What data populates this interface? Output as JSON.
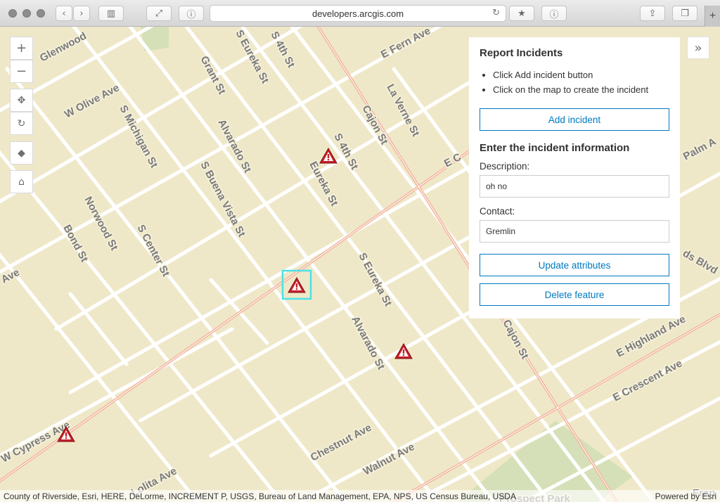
{
  "browser": {
    "url": "developers.arcgis.com"
  },
  "map": {
    "road_color": "#ffffff",
    "highway_color": "#f2b59e",
    "land_color": "#efe8c8",
    "park_color": "#d5e0b8",
    "accent_color": "#4ee0e6",
    "incident_icon": "warning-triangle-icon",
    "street_labels": [
      {
        "text": "Glenwood"
      },
      {
        "text": "W Olive Ave"
      },
      {
        "text": "S Michigan St"
      },
      {
        "text": "Grant St"
      },
      {
        "text": "S Eureka St"
      },
      {
        "text": "S 4th St"
      },
      {
        "text": "E Fern Ave"
      },
      {
        "text": "La Verne St"
      },
      {
        "text": "Cajon St"
      },
      {
        "text": "Alvarado St"
      },
      {
        "text": "S 4th St"
      },
      {
        "text": "Eureka St"
      },
      {
        "text": "S Buena Vista St"
      },
      {
        "text": "Norwood St"
      },
      {
        "text": "Bond St"
      },
      {
        "text": "S Center St"
      },
      {
        "text": "Ave"
      },
      {
        "text": "S Eureka St"
      },
      {
        "text": "Alvarado St"
      },
      {
        "text": "Cajon St"
      },
      {
        "text": "E Highland Ave"
      },
      {
        "text": "E Crescent Ave"
      },
      {
        "text": "Palm A"
      },
      {
        "text": "ds Blvd"
      },
      {
        "text": "E C"
      },
      {
        "text": "W Cypress Ave"
      },
      {
        "text": "Chestnut Ave"
      },
      {
        "text": "Walnut Ave"
      },
      {
        "text": "Lolita Ave"
      },
      {
        "text": "Prospect Park"
      },
      {
        "text": "Fran"
      }
    ]
  },
  "panel": {
    "title": "Report Incidents",
    "instructions": [
      "Click Add incident button",
      "Click on the map to create the incident"
    ],
    "add_button": "Add incident",
    "form_title": "Enter the incident information",
    "description_label": "Description:",
    "description_value": "oh no",
    "contact_label": "Contact:",
    "contact_value": "Gremlin",
    "update_button": "Update attributes",
    "delete_button": "Delete feature"
  },
  "attribution": {
    "sources": "County of Riverside, Esri, HERE, DeLorme, INCREMENT P, USGS, Bureau of Land Management, EPA, NPS, US Census Bureau, USDA",
    "powered": "Powered by Esri"
  }
}
